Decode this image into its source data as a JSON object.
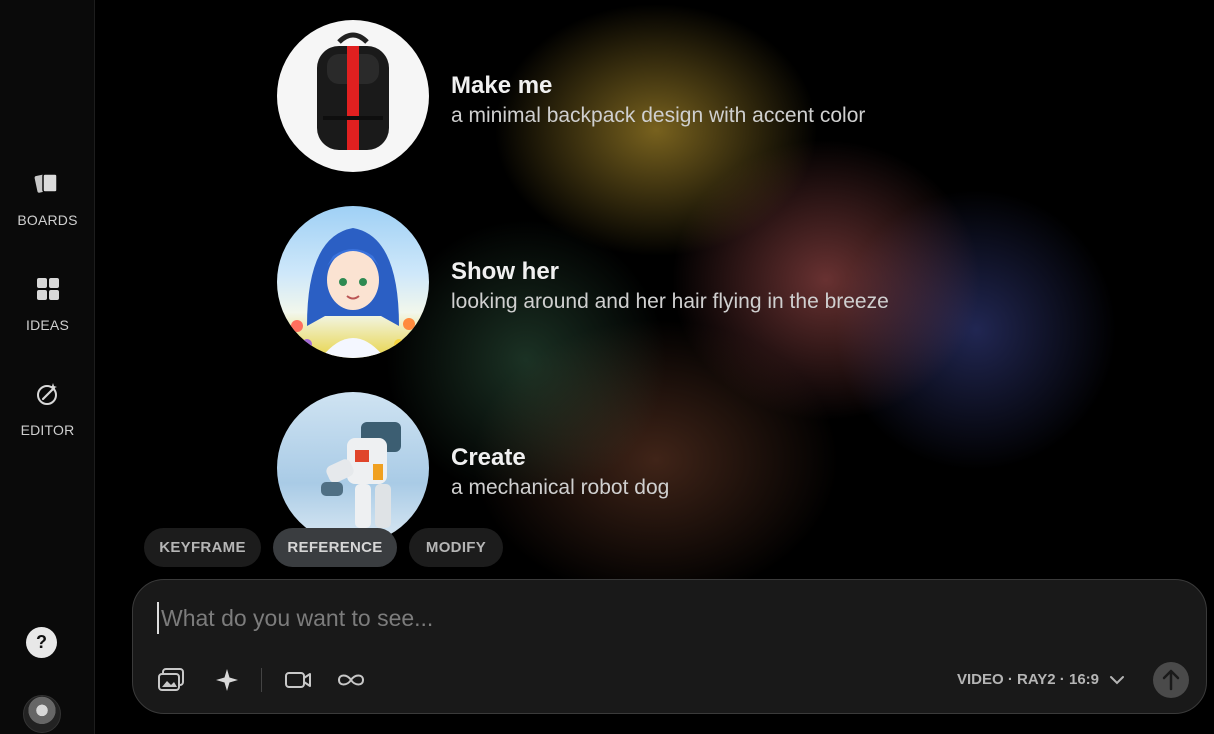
{
  "sidebar": {
    "items": [
      {
        "label": "BOARDS",
        "icon": "boards-icon"
      },
      {
        "label": "IDEAS",
        "icon": "ideas-grid-icon"
      },
      {
        "label": "EDITOR",
        "icon": "editor-icon"
      }
    ],
    "help_label": "?"
  },
  "suggestions": [
    {
      "title": "Make me",
      "description": "a minimal backpack design with accent color",
      "image": "backpack-image"
    },
    {
      "title": "Show her",
      "description": "looking around and her hair flying in the breeze",
      "image": "anime-girl-image"
    },
    {
      "title": "Create",
      "description": "a mechanical robot dog",
      "image": "robot-image"
    }
  ],
  "modes": [
    {
      "label": "KEYFRAME",
      "active": false
    },
    {
      "label": "REFERENCE",
      "active": true
    },
    {
      "label": "MODIFY",
      "active": false
    }
  ],
  "prompt": {
    "placeholder": "What do you want to see...",
    "value": "",
    "model_label": "VIDEO · RAY2 · 16:9"
  },
  "colors": {
    "background": "#000000",
    "sidebar": "#0a0a0a",
    "prompt_bg": "#191919",
    "active_pill": "#3a3d40",
    "backpack_accent": "#e02020"
  }
}
